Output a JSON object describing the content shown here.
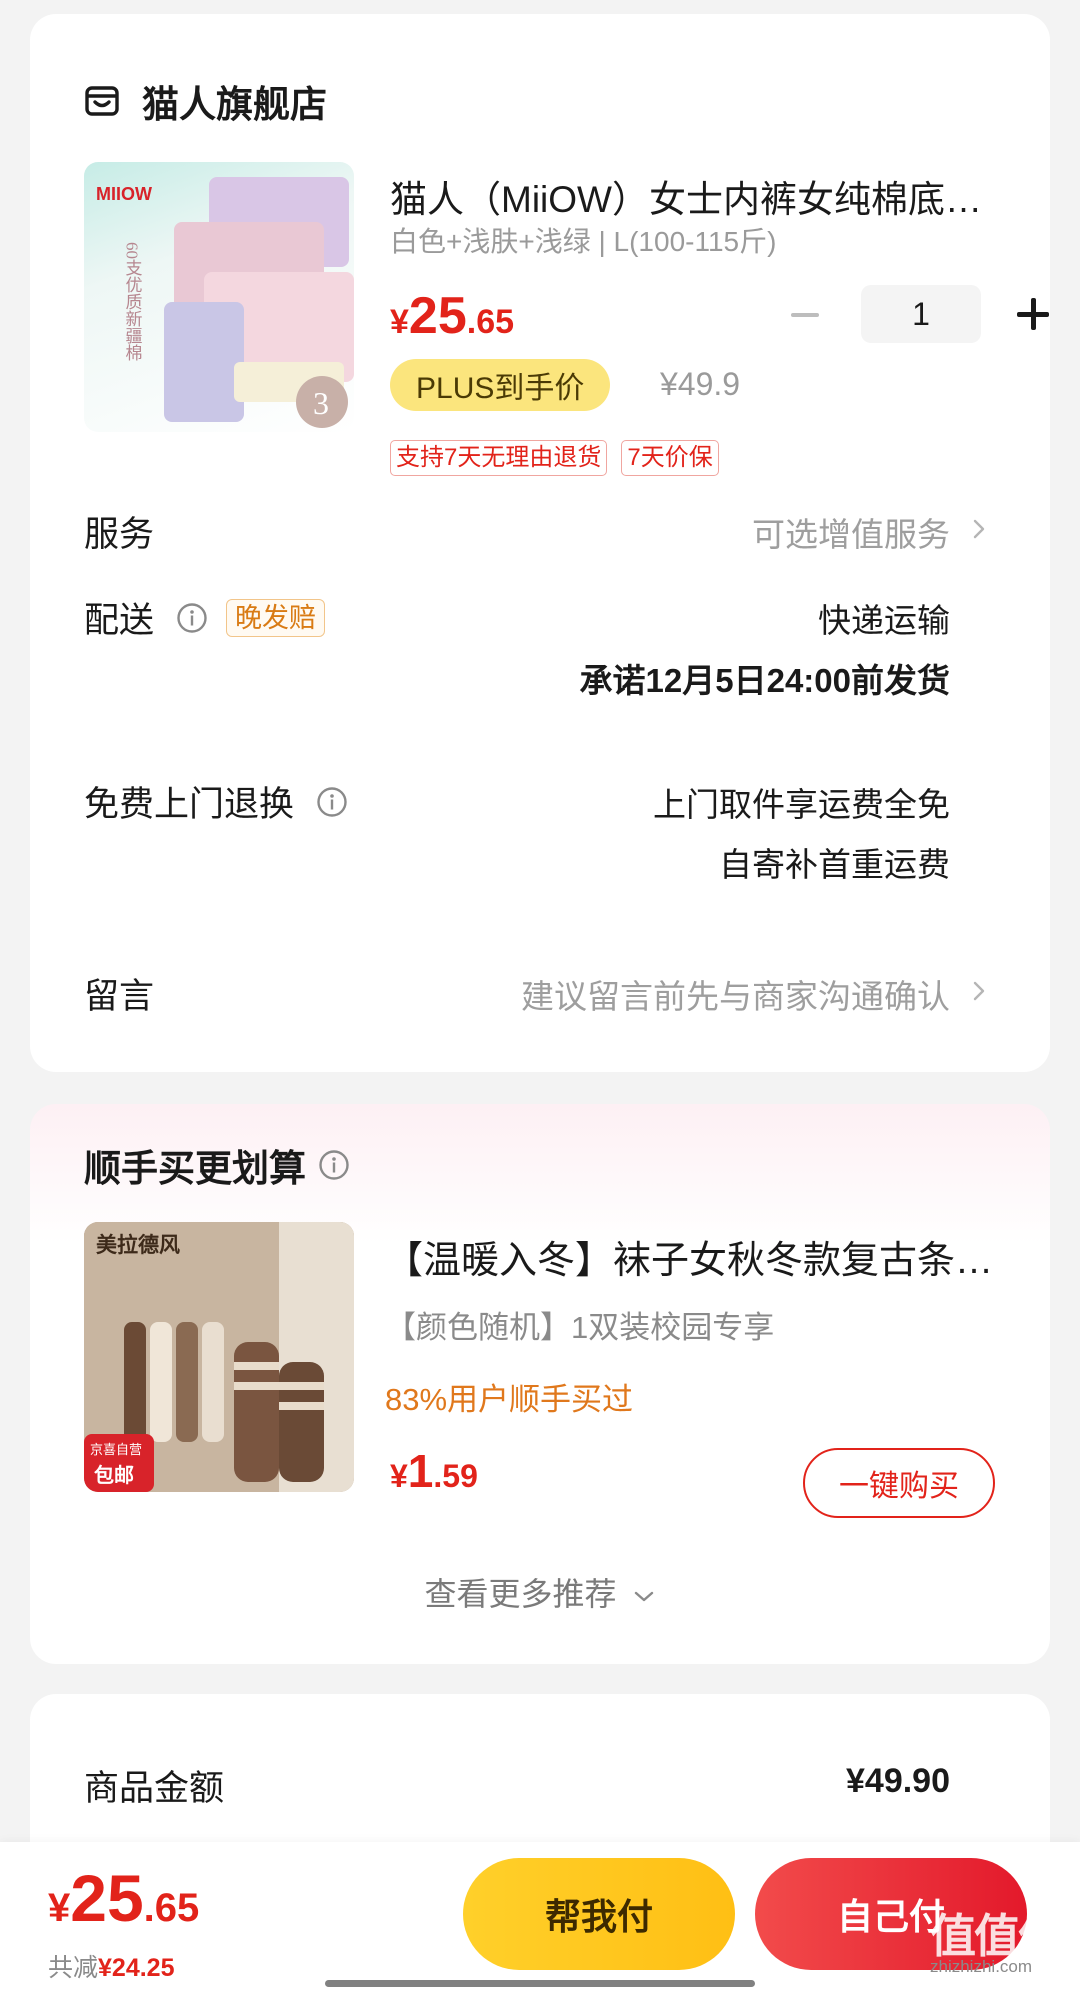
{
  "colors": {
    "accent_red": "#e2231a",
    "plus_yellow": "#fbe57d",
    "help_pay_yellow": "#ffc51f",
    "social_orange": "#e0781c"
  },
  "store": {
    "name": "猫人旗舰店",
    "icon": "store-icon"
  },
  "product": {
    "image_brand": "MIIOW",
    "image_text": "60支优质新疆棉",
    "title": "猫人（MiiOW）女士内裤女纯棉底裆抗菌",
    "spec": "白色+浅肤+浅绿 | L(100-115斤)",
    "price": {
      "symbol": "¥",
      "integer": "25",
      "decimal": ".65"
    },
    "quantity": "1",
    "plus_label": "PLUS到手价",
    "original_price": "¥49.9",
    "tags": [
      "支持7天无理由退货",
      "7天价保"
    ]
  },
  "service": {
    "label": "服务",
    "value": "可选增值服务"
  },
  "delivery": {
    "label": "配送",
    "badge": "晚发赔",
    "method": "快递运输",
    "promise": "承诺12月5日24:00前发货"
  },
  "return": {
    "label": "免费上门退换",
    "line1": "上门取件享运费全免",
    "line2": "自寄补首重运费"
  },
  "message": {
    "label": "留言",
    "placeholder": "建议留言前先与商家沟通确认"
  },
  "recommend": {
    "title": "顺手买更划算",
    "item": {
      "image_brand": "美拉德风",
      "image_badge_top": "京喜自营",
      "image_badge_bottom": "包邮",
      "name": "【温暖入冬】袜子女秋冬款复古条纹中筒袜",
      "desc": "【颜色随机】1双装校园专享",
      "social": "83%用户顺手买过",
      "price": {
        "symbol": "¥",
        "integer": "1",
        "decimal": ".59"
      },
      "buy_label": "一键购买"
    },
    "more_label": "查看更多推荐"
  },
  "summary": {
    "goods_amount_label": "商品金额",
    "goods_amount_value": "¥49.90"
  },
  "bottom": {
    "total": {
      "symbol": "¥",
      "integer": "25",
      "decimal": ".65"
    },
    "discount_label": "共减",
    "discount_value": "¥24.25",
    "help_pay_label": "帮我付",
    "self_pay_label": "自己付"
  },
  "watermark": {
    "main": "值值值",
    "sub": "zhizhizhi.com"
  }
}
